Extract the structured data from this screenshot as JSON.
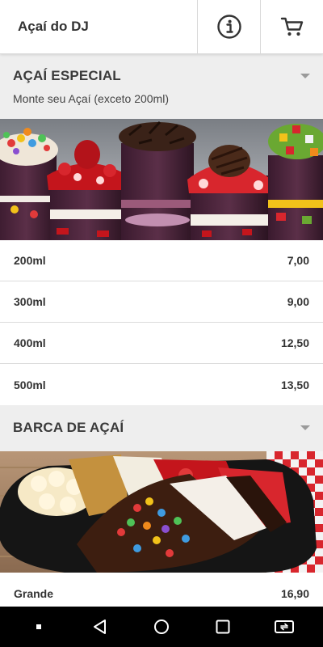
{
  "app": {
    "title": "Açaí do DJ"
  },
  "header": {
    "info_icon": "info-icon",
    "cart_icon": "cart-icon"
  },
  "sections": [
    {
      "title": "AÇAÍ ESPECIAL",
      "subtitle": "Monte seu Açaí (exceto 200ml)",
      "items": [
        {
          "name": "200ml",
          "price": "7,00"
        },
        {
          "name": "300ml",
          "price": "9,00"
        },
        {
          "name": "400ml",
          "price": "12,50"
        },
        {
          "name": "500ml",
          "price": "13,50"
        }
      ]
    },
    {
      "title": "BARCA DE AÇAÍ",
      "items": [
        {
          "name": "Grande",
          "price": "16,90"
        }
      ]
    }
  ],
  "navbar": {
    "icons": [
      "dot-icon",
      "back-icon",
      "home-icon",
      "recents-icon",
      "rotate-icon"
    ]
  },
  "colors": {
    "header_bg": "#eeeeee",
    "navbar_bg": "#000000",
    "divider": "#dcdcdc"
  }
}
